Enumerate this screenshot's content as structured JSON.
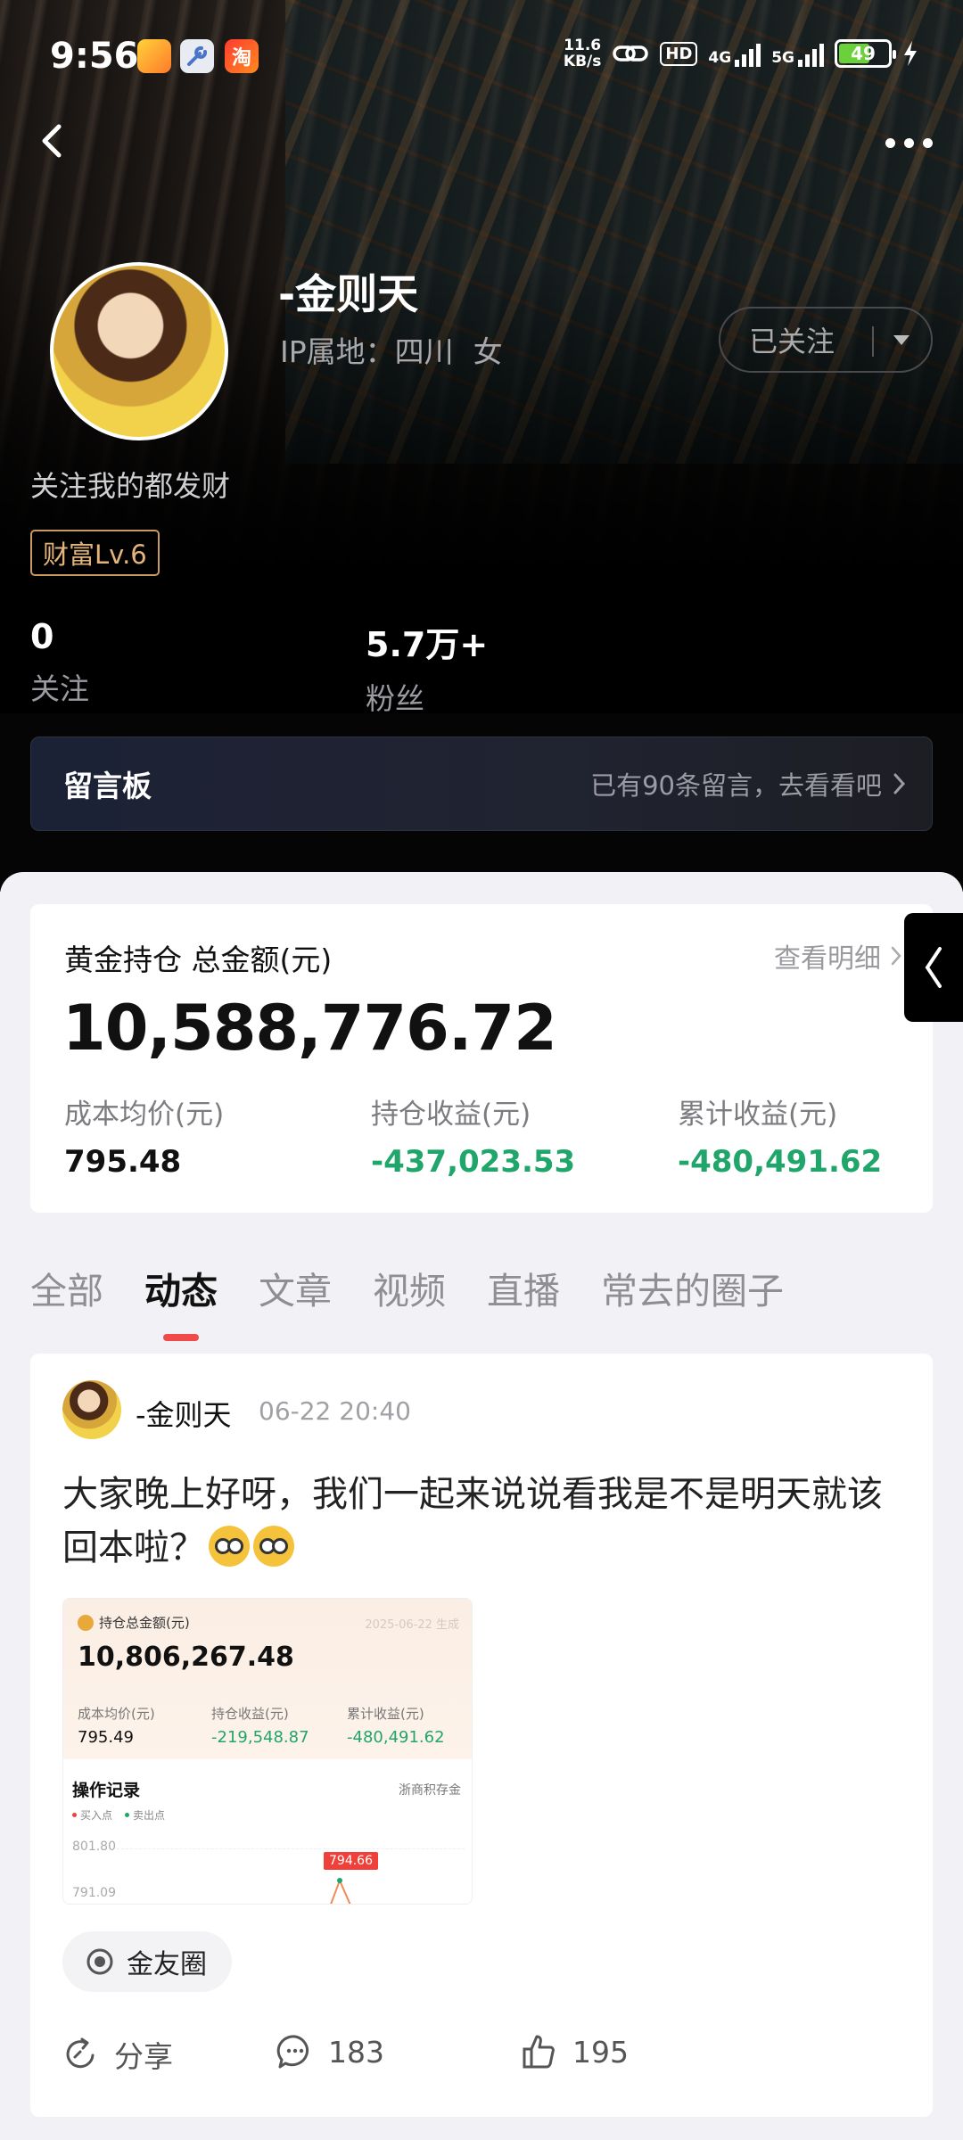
{
  "status_bar": {
    "time": "9:56",
    "net_speed_value": "11.6",
    "net_speed_unit": "KB/s",
    "hd_label": "HD",
    "signal1": "4G",
    "signal2": "5G",
    "battery": "49"
  },
  "profile": {
    "name": "-金则天",
    "ip_location": "IP属地：四川",
    "gender": "女",
    "follow_button": "已关注",
    "bio": "关注我的都发财",
    "level_badge": "财富Lv.6",
    "following_count": "0",
    "following_label": "关注",
    "fans_count": "5.7万+",
    "fans_label": "粉丝"
  },
  "message_board": {
    "title": "留言板",
    "hint": "已有90条留言，去看看吧"
  },
  "gold": {
    "title": "黄金持仓 总金额(元)",
    "detail_link": "查看明细",
    "total": "10,588,776.72",
    "avg_cost_label": "成本均价(元)",
    "avg_cost": "795.48",
    "holding_profit_label": "持仓收益(元)",
    "holding_profit": "-437,023.53",
    "total_profit_label": "累计收益(元)",
    "total_profit": "-480,491.62"
  },
  "tabs": [
    "全部",
    "动态",
    "文章",
    "视频",
    "直播",
    "常去的圈子"
  ],
  "active_tab": "动态",
  "post": {
    "author": "-金则天",
    "time": "06-22 20:40",
    "text": "大家晚上好呀，我们一起来说说看我是不是明天就该回本啦？",
    "image": {
      "title": "持仓总金额(元)",
      "date": "2025-06-22 生成",
      "total": "10,806,267.48",
      "avg_cost_label": "成本均价(元)",
      "avg_cost": "795.49",
      "holding_profit_label": "持仓收益(元)",
      "holding_profit": "-219,548.87",
      "total_profit_label": "累计收益(元)",
      "total_profit": "-480,491.62",
      "ops_title": "操作记录",
      "bank": "浙商积存金",
      "legend_buy": "买入点",
      "legend_sell": "卖出点",
      "y_high": "801.80",
      "y_low": "791.09",
      "price_tag": "794.66"
    },
    "circle": "金友圈",
    "share_label": "分享",
    "comments": "183",
    "likes": "195"
  },
  "colors": {
    "negative": "#20a66a",
    "tab_indicator": "#f04a4a",
    "level_badge": "#e3b57a"
  }
}
